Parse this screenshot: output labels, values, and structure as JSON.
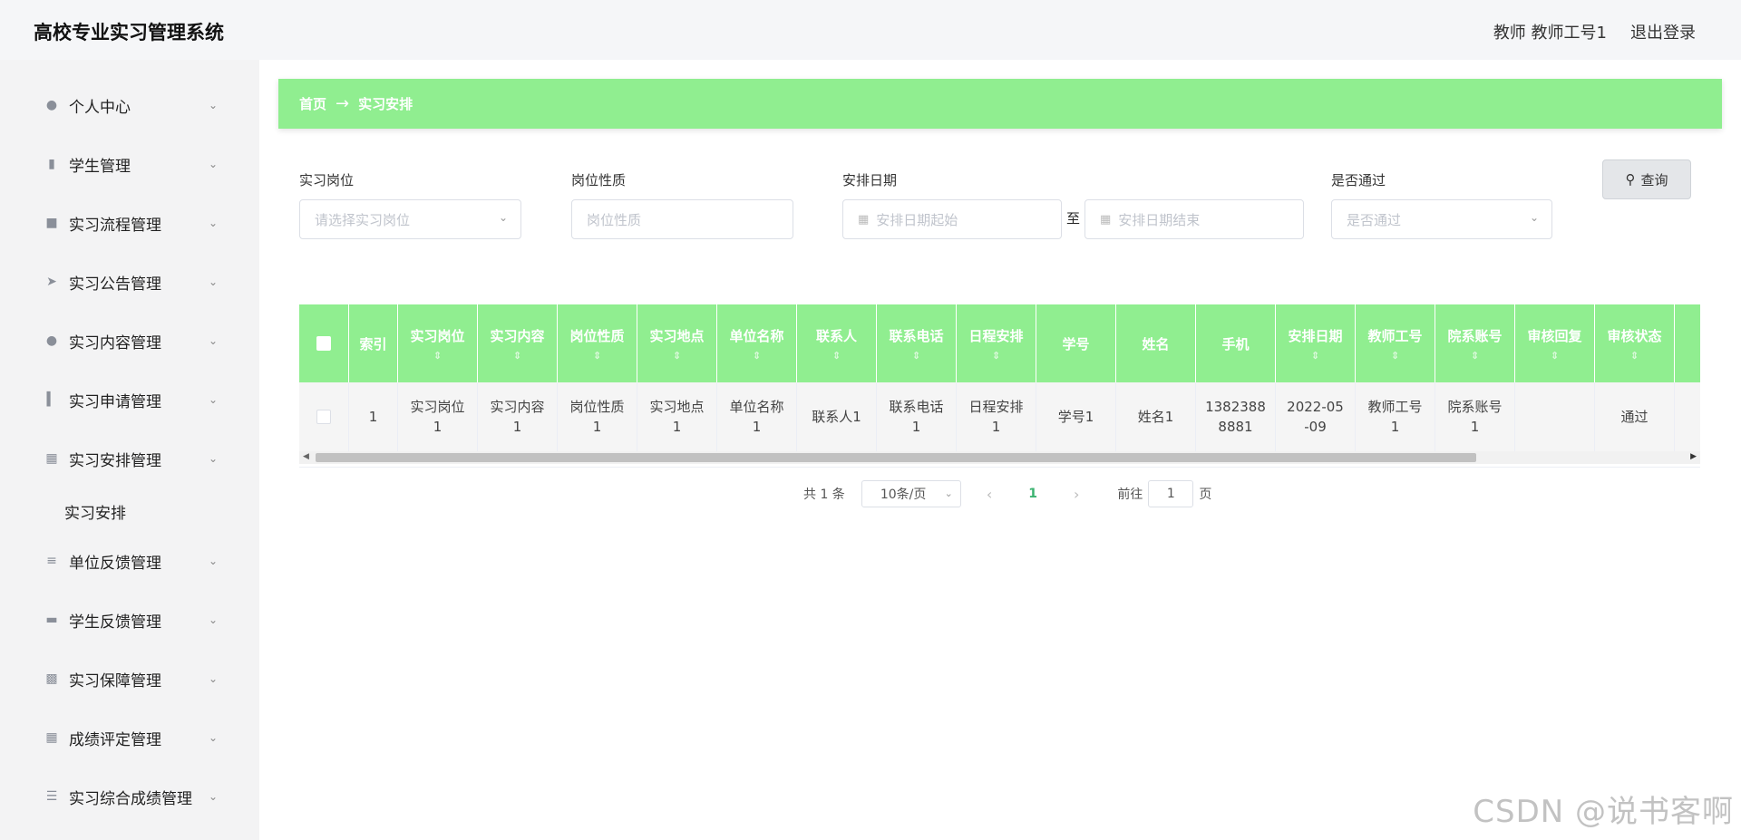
{
  "header": {
    "title": "高校专业实习管理系统",
    "user": "教师 教师工号1",
    "logout": "退出登录"
  },
  "sidebar": {
    "items": [
      {
        "label": "个人中心",
        "icon": "user-icon"
      },
      {
        "label": "学生管理",
        "icon": "clipboard-icon"
      },
      {
        "label": "实习流程管理",
        "icon": "chat-icon"
      },
      {
        "label": "实习公告管理",
        "icon": "send-icon"
      },
      {
        "label": "实习内容管理",
        "icon": "user-icon"
      },
      {
        "label": "实习申请管理",
        "icon": "bar-chart-icon"
      },
      {
        "label": "实习安排管理",
        "icon": "grid-icon"
      },
      {
        "label": "单位反馈管理",
        "icon": "sliders-icon"
      },
      {
        "label": "学生反馈管理",
        "icon": "ticket-icon"
      },
      {
        "label": "实习保障管理",
        "icon": "monitor-icon"
      },
      {
        "label": "成绩评定管理",
        "icon": "grid-icon"
      },
      {
        "label": "实习综合成绩管理",
        "icon": "list-icon"
      }
    ],
    "sub_item": "实习安排"
  },
  "breadcrumb": {
    "home": "首页",
    "separator": "→",
    "current": "实习安排"
  },
  "search": {
    "position_label": "实习岗位",
    "position_placeholder": "请选择实习岗位",
    "nature_label": "岗位性质",
    "nature_placeholder": "岗位性质",
    "date_label": "安排日期",
    "date_start_placeholder": "安排日期起始",
    "date_to": "至",
    "date_end_placeholder": "安排日期结束",
    "passed_label": "是否通过",
    "passed_placeholder": "是否通过",
    "query_button": "查询"
  },
  "table": {
    "columns": [
      "索引",
      "实习岗位",
      "实习内容",
      "岗位性质",
      "实习地点",
      "单位名称",
      "联系人",
      "联系电话",
      "日程安排",
      "学号",
      "姓名",
      "手机",
      "安排日期",
      "教师工号",
      "院系账号",
      "审核回复",
      "审核状态"
    ],
    "rows": [
      [
        "1",
        "实习岗位1",
        "实习内容1",
        "岗位性质1",
        "实习地点1",
        "单位名称1",
        "联系人1",
        "联系电话1",
        "日程安排1",
        "学号1",
        "姓名1",
        "13823888881",
        "2022-05-09",
        "教师工号1",
        "院系账号1",
        "",
        "通过"
      ]
    ]
  },
  "pagination": {
    "total": "共 1 条",
    "page_size": "10条/页",
    "current_page": "1",
    "goto_label": "前往",
    "goto_value": "1",
    "page_suffix": "页"
  },
  "watermark": "CSDN @说书客啊",
  "colors": {
    "accent_green": "#90ee90",
    "active_page": "#3cb371"
  }
}
